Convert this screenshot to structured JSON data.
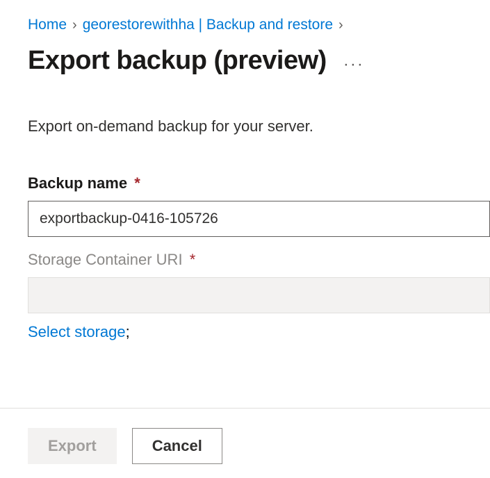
{
  "breadcrumb": {
    "home": "Home",
    "resource": "georestorewithha | Backup and restore"
  },
  "page": {
    "title": "Export backup (preview)",
    "description": "Export on-demand backup for your server."
  },
  "form": {
    "backup_name_label": "Backup name",
    "backup_name_value": "exportbackup-0416-105726",
    "storage_uri_label": "Storage Container URI",
    "storage_uri_value": "",
    "select_storage_link": "Select storage",
    "select_storage_suffix": ";",
    "required_mark": "*"
  },
  "footer": {
    "export_label": "Export",
    "cancel_label": "Cancel"
  }
}
